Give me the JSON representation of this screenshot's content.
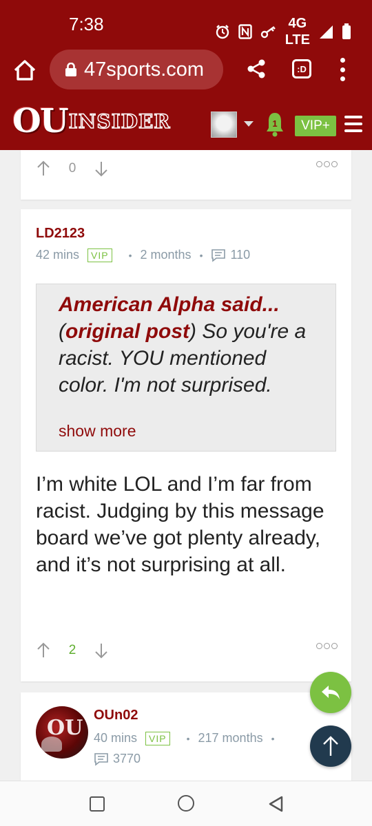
{
  "status_bar": {
    "time": "7:38",
    "network_top": "4G",
    "network_bottom": "LTE",
    "icons": [
      "alarm-icon",
      "nfc-icon",
      "key-icon",
      "signal-icon",
      "battery-icon"
    ]
  },
  "browser": {
    "url": "47sports.com",
    "tab_label": ":D"
  },
  "site_header": {
    "logo_main": "OU",
    "logo_sub": "INSIDER",
    "notification_count": "1",
    "vip_label": "VIP+"
  },
  "colors": {
    "brand": "#8f0a0a",
    "accent_green": "#7cc142",
    "scroll_top_bg": "#213a4e"
  },
  "previous_post": {
    "vote_count": "0"
  },
  "post": {
    "username": "LD2123",
    "time_ago": "42 mins",
    "vip_tag": "VIP",
    "member_for": "2 months",
    "post_count": "110",
    "quote": {
      "author": "American Alpha said...",
      "link_open": "(",
      "link_text": "original post",
      "link_close": ")",
      "text": " So you're a racist. YOU mentioned color. I'm not surprised.",
      "show_more": "show more"
    },
    "body": "I’m white LOL and I’m far from racist. Judging by this message board we’ve got plenty already, and it’s not surprising at all.",
    "vote_count": "2"
  },
  "next_post": {
    "username": "OUn02",
    "time_ago": "40 mins",
    "vip_tag": "VIP",
    "member_for": "217 months",
    "post_count": "3770",
    "avatar_mark": "OU"
  }
}
